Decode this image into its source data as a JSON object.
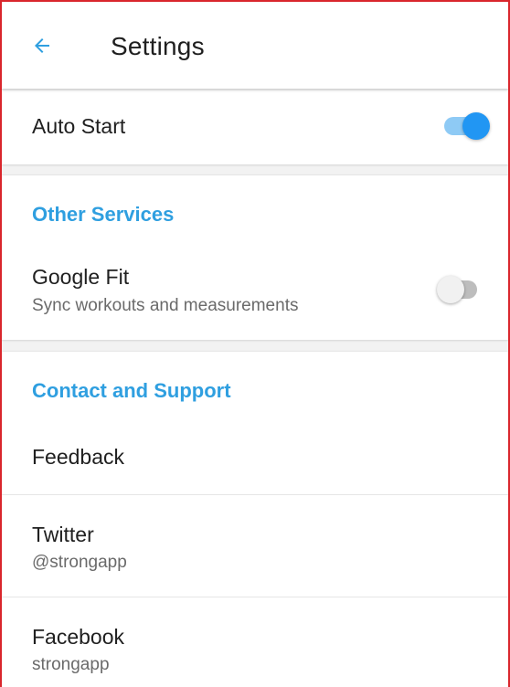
{
  "header": {
    "title": "Settings",
    "back_icon": "arrow-left-icon"
  },
  "colors": {
    "accent": "#2f9fe0",
    "toggle_on": "#2196f3",
    "border": "#d9262c"
  },
  "auto_start": {
    "label": "Auto Start",
    "enabled": true
  },
  "other_services": {
    "heading": "Other Services",
    "google_fit": {
      "label": "Google Fit",
      "subtitle": "Sync workouts and measurements",
      "enabled": false
    }
  },
  "contact_support": {
    "heading": "Contact and Support",
    "items": [
      {
        "label": "Feedback"
      },
      {
        "label": "Twitter",
        "subtitle": "@strongapp"
      },
      {
        "label": "Facebook",
        "subtitle": "strongapp"
      }
    ]
  }
}
